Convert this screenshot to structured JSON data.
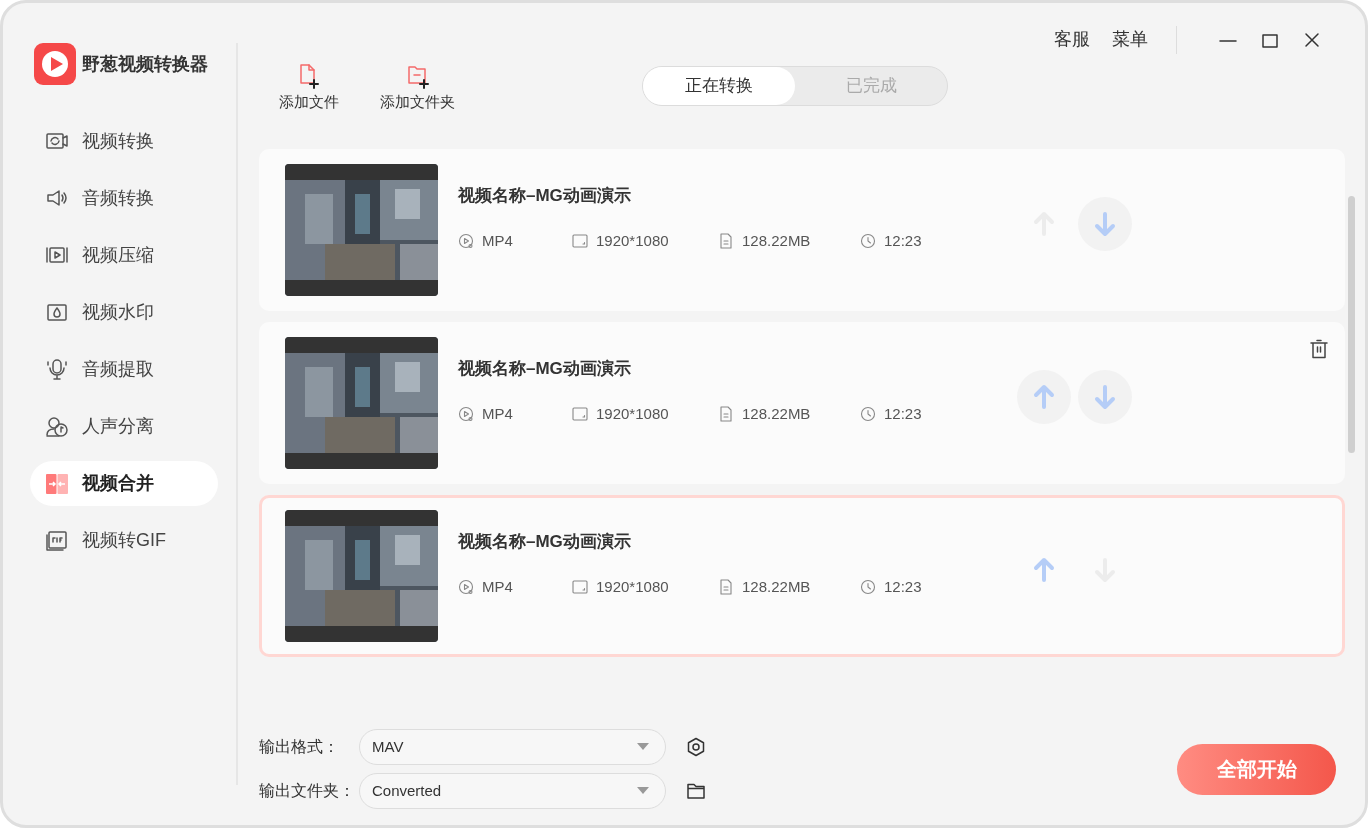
{
  "app": {
    "title": "野葱视频转换器"
  },
  "sidebar": {
    "items": [
      {
        "label": "视频转换",
        "selected": false
      },
      {
        "label": "音频转换",
        "selected": false
      },
      {
        "label": "视频压缩",
        "selected": false
      },
      {
        "label": "视频水印",
        "selected": false
      },
      {
        "label": "音频提取",
        "selected": false
      },
      {
        "label": "人声分离",
        "selected": false
      },
      {
        "label": "视频合并",
        "selected": true
      },
      {
        "label": "视频转GIF",
        "selected": false
      }
    ]
  },
  "header_links": [
    "客服",
    "菜单"
  ],
  "toolbar": [
    {
      "label": "添加文件"
    },
    {
      "label": "添加文件夹"
    }
  ],
  "tabs": [
    {
      "label": "正在转换",
      "selected": true
    },
    {
      "label": "已完成",
      "selected": false
    }
  ],
  "files": [
    {
      "title": "视频名称–MG动画演示",
      "format": "MP4",
      "resolution": "1920*1080",
      "size": "128.22MB",
      "duration": "12:23",
      "selected": false,
      "hovered": false,
      "up_enabled": false,
      "down_enabled": true
    },
    {
      "title": "视频名称–MG动画演示",
      "format": "MP4",
      "resolution": "1920*1080",
      "size": "128.22MB",
      "duration": "12:23",
      "selected": false,
      "hovered": true,
      "up_enabled": true,
      "down_enabled": true
    },
    {
      "title": "视频名称–MG动画演示",
      "format": "MP4",
      "resolution": "1920*1080",
      "size": "128.22MB",
      "duration": "12:23",
      "selected": true,
      "hovered": false,
      "up_enabled": true,
      "down_enabled": false
    }
  ],
  "output": {
    "format_label": "输出格式：",
    "format_value": "MAV",
    "folder_label": "输出文件夹：",
    "folder_value": "Converted"
  },
  "start_button": "全部开始"
}
